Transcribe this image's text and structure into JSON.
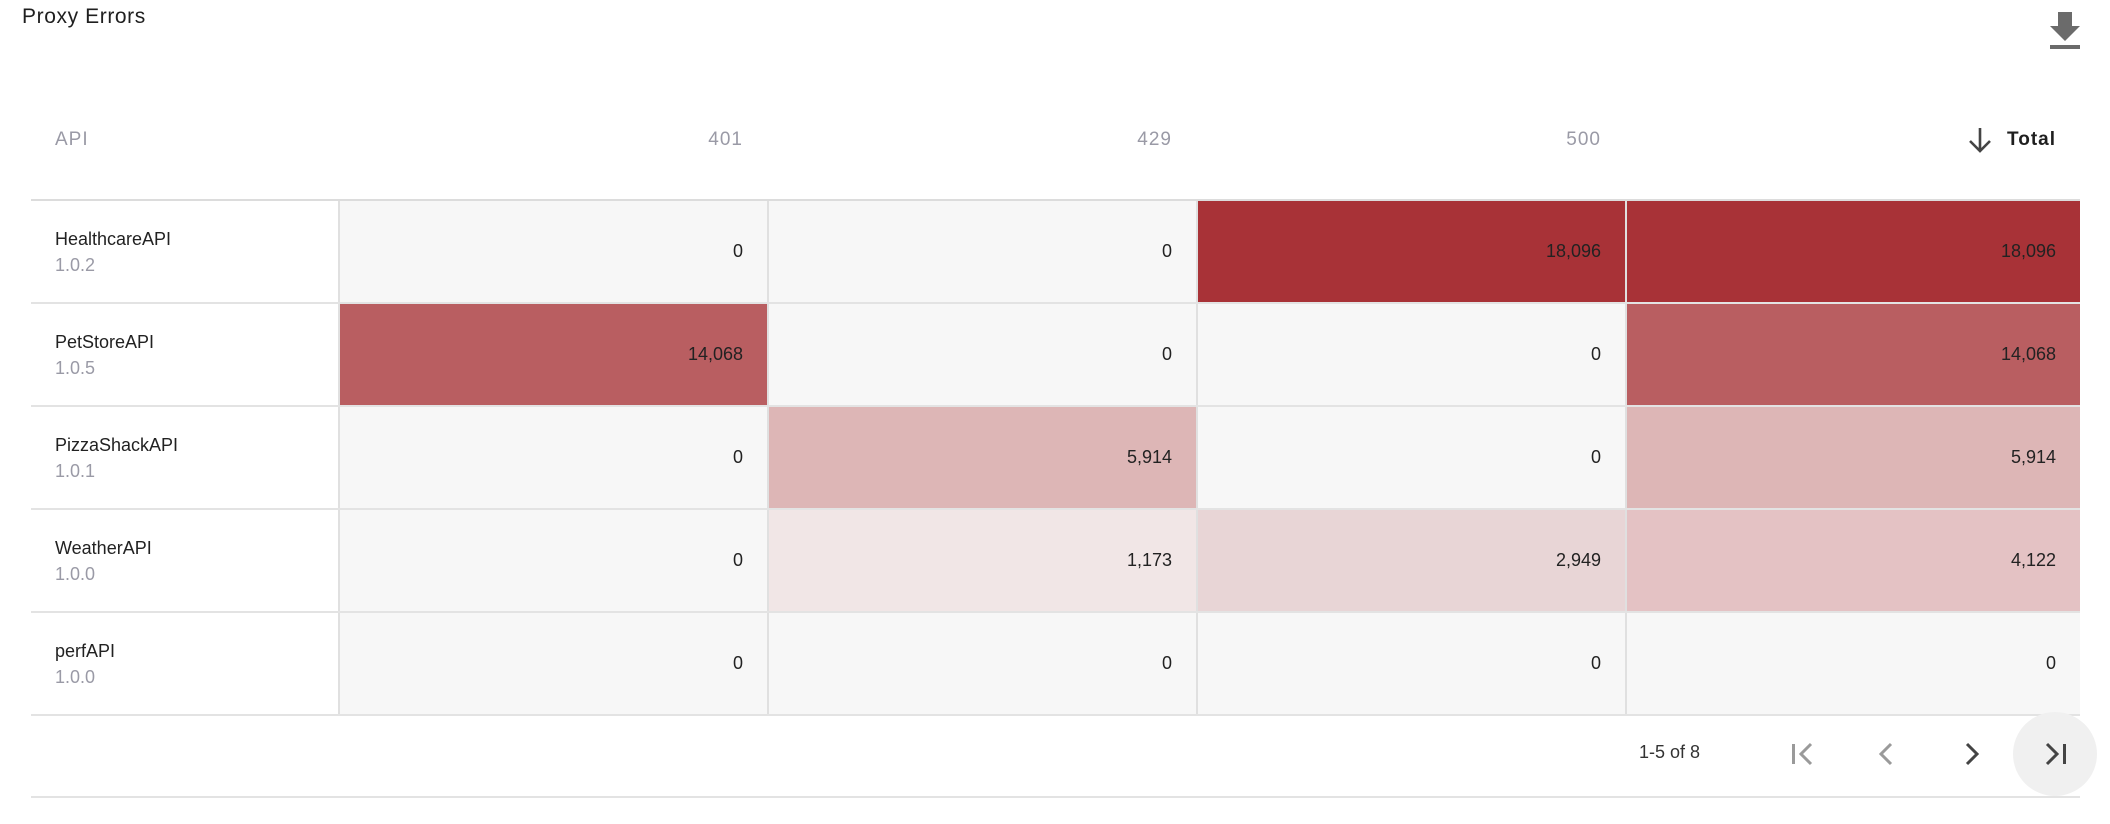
{
  "title": "Proxy Errors",
  "download_icon": "download-icon",
  "columns": {
    "api": "API",
    "c401": "401",
    "c429": "429",
    "c500": "500",
    "total": "Total"
  },
  "sort": {
    "column": "Total",
    "direction": "desc",
    "icon": "arrow-down-icon"
  },
  "rows": [
    {
      "name": "HealthcareAPI",
      "version": "1.0.2",
      "c401": "0",
      "c429": "0",
      "c500": "18,096",
      "total": "18,096"
    },
    {
      "name": "PetStoreAPI",
      "version": "1.0.5",
      "c401": "14,068",
      "c429": "0",
      "c500": "0",
      "total": "14,068"
    },
    {
      "name": "PizzaShackAPI",
      "version": "1.0.1",
      "c401": "0",
      "c429": "5,914",
      "c500": "0",
      "total": "5,914"
    },
    {
      "name": "WeatherAPI",
      "version": "1.0.0",
      "c401": "0",
      "c429": "1,173",
      "c500": "2,949",
      "total": "4,122"
    },
    {
      "name": "perfAPI",
      "version": "1.0.0",
      "c401": "0",
      "c429": "0",
      "c500": "0",
      "total": "0"
    }
  ],
  "heat_colors": {
    "empty": "#f7f7f7",
    "max": "#a83237",
    "high": "#b95e61",
    "mid": "#ddb6b6",
    "low_total": "#e4c2c4",
    "low_500": "#e8d5d6",
    "low_429": "#f1e6e6"
  },
  "pagination": {
    "range_text": "1-5 of 8",
    "first_icon": "first-page-icon",
    "prev_icon": "chevron-left-icon",
    "next_icon": "chevron-right-icon",
    "last_icon": "last-page-icon"
  }
}
